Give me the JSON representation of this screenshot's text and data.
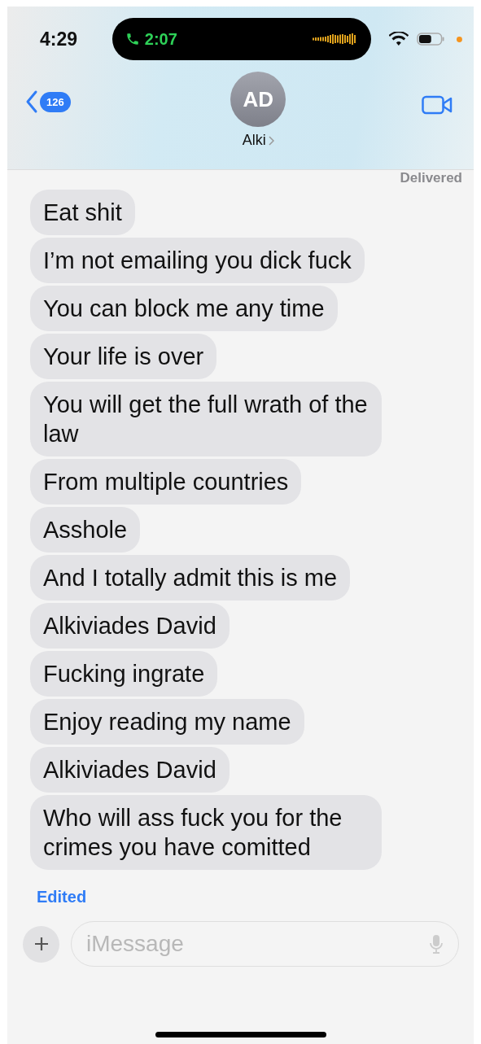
{
  "status_bar": {
    "time": "4:29",
    "call_time": "2:07"
  },
  "header": {
    "back_count": "126",
    "avatar_initials": "AD",
    "contact_name": "Alki"
  },
  "delivered": "Delivered",
  "messages": [
    {
      "text": "Eat shit"
    },
    {
      "text": "I’m not emailing you dick fuck"
    },
    {
      "text": "You can block me any time"
    },
    {
      "text": "Your life is over"
    },
    {
      "text": "You will get the full wrath of the law"
    },
    {
      "text": "From multiple countries"
    },
    {
      "text": "Asshole"
    },
    {
      "text": "And I totally admit this is me"
    },
    {
      "text": "Alkiviades David"
    },
    {
      "text": "Fucking ingrate"
    },
    {
      "text": "Enjoy reading my name"
    },
    {
      "text": "Alkiviades David"
    },
    {
      "text": "Who will ass fuck you for the crimes you have comitted"
    }
  ],
  "edited": "Edited",
  "composer": {
    "placeholder": "iMessage"
  }
}
